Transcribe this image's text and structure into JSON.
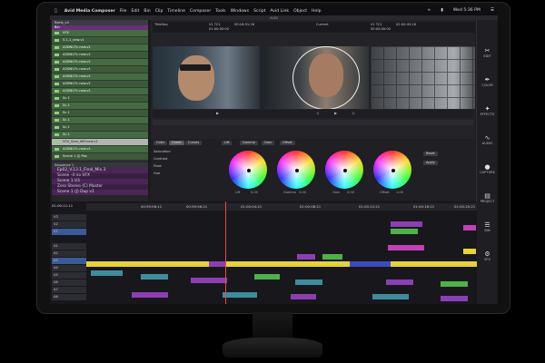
{
  "menubar": {
    "app_name": "Avid Media Composer",
    "menus": [
      "File",
      "Edit",
      "Bin",
      "Clip",
      "Timeline",
      "Composer",
      "Tools",
      "Windows",
      "Script",
      "Avid Link",
      "Object",
      "Help"
    ],
    "clock": "Wed 5:36 PM"
  },
  "window": {
    "title": "AVID"
  },
  "bin": {
    "tab": "Reels_v4",
    "header": "Bin",
    "items": [
      "VFX",
      "5.1-1_new.v1",
      "A0DNU7c.new.v1",
      "A0DNU7c.new.v1",
      "A0DNU7c.new.v1",
      "A0DNU7c.new.v1",
      "A0DNU7c.new.v1",
      "A0DNU7c.new.v1",
      "A0DNU7c.new.v1",
      "Sc.1",
      "Sc.1",
      "Sc.1",
      "Sc.1",
      "Sc.1",
      "Sc.1",
      "VFX_Shot_WIP.new.v1",
      "A0DNU7c.new.v1",
      "Scene 1 (J) Pos"
    ],
    "selected_index": 15,
    "sequence_header": "Sequence 1",
    "sequences": [
      "Ep02_V.13.1_Final_Mix 3",
      "Scene -4 no VFX",
      "Scene 1.V3",
      "Zero Stereo (C) Master",
      "Scene 1 (J) Dup v1"
    ]
  },
  "monitors": {
    "source": {
      "name": "TitleSeq",
      "tc_label": "V1 TC1",
      "tc_value": "00:18:51:16"
    },
    "record": {
      "name": "Current",
      "tc_label": "V1 TC1",
      "tc_value": "02:00:45:16"
    },
    "tc_a": "01:00:00:00",
    "tc_b": "00:00:00:00"
  },
  "color_panel": {
    "tabs": [
      "Color",
      "Grade",
      "Curves",
      "Lift",
      "Gamma",
      "Gain",
      "Offset"
    ],
    "wheels": [
      "Lift",
      "Gamma",
      "Gain",
      "Offset"
    ],
    "values": [
      "0.00",
      "0.00",
      "0.00",
      "1.00"
    ],
    "labels": [
      "Saturation",
      "Contrast",
      "Pivot",
      "Hue"
    ],
    "right_buttons": [
      "Reset",
      "Apply"
    ]
  },
  "sidebar": {
    "items": [
      "EDIT",
      "COLOR",
      "EFFECTS",
      "AUDIO",
      "CAPTURE",
      "PROJECT",
      "BIN",
      "SFX"
    ]
  },
  "timeline": {
    "tracks": [
      "V3",
      "V2",
      "V1",
      "A1",
      "A2",
      "A3",
      "A4",
      "A5",
      "A6",
      "A7",
      "A8",
      "A9"
    ],
    "ruler": [
      "01:00:10:00",
      "00:59:56:11",
      "00:59:56:21",
      "01:00:04:21",
      "01:00:08:21",
      "01:00:12:21",
      "01:00:16:21",
      "01:00:20:21"
    ],
    "position": "01:00:11:11"
  }
}
